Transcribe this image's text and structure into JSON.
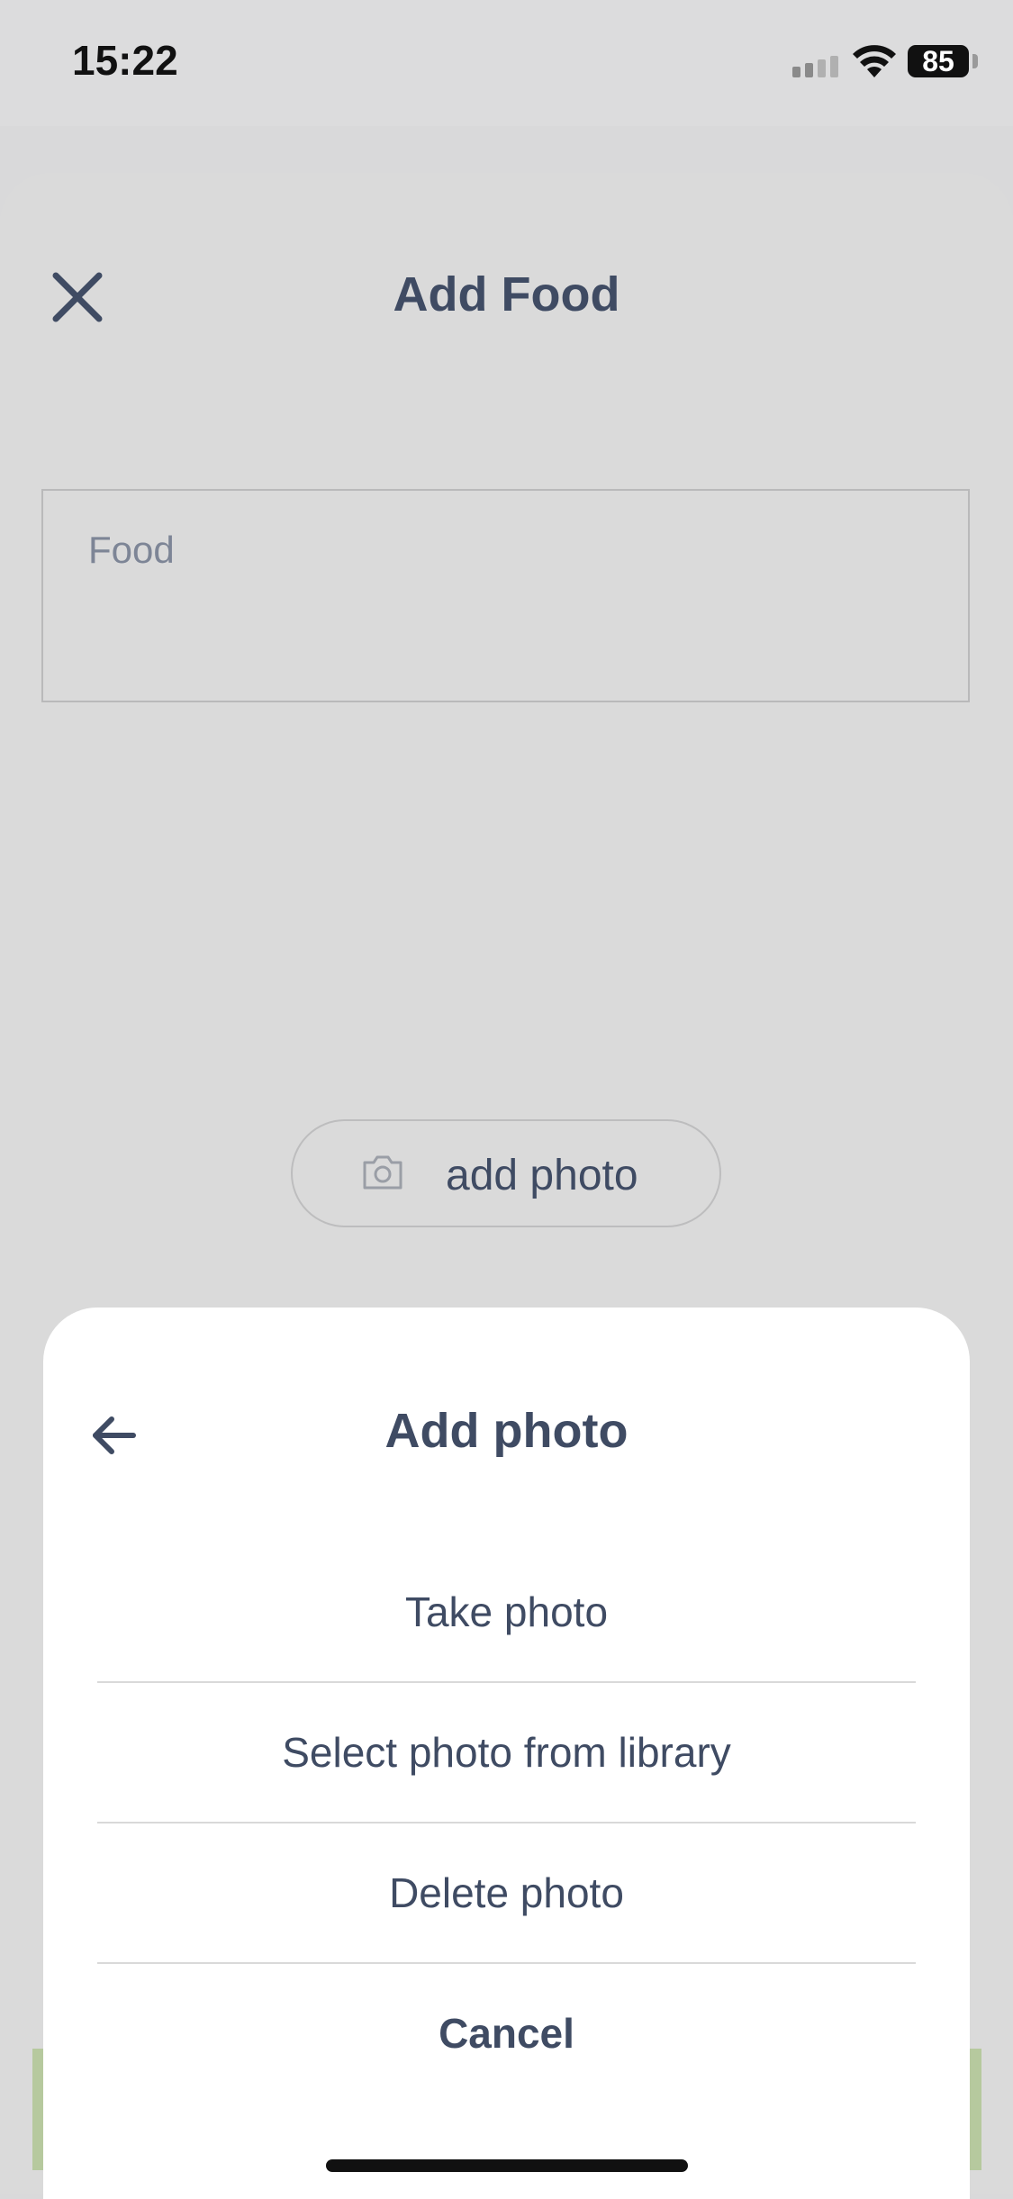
{
  "status_bar": {
    "time": "15:22",
    "battery": "85"
  },
  "header": {
    "title": "Add Food",
    "close_icon": "close-icon"
  },
  "form": {
    "food_placeholder": "Food",
    "add_photo_label": "add photo",
    "camera_icon": "camera-icon"
  },
  "action_sheet": {
    "title": "Add photo",
    "back_icon": "arrow-left-icon",
    "options": [
      {
        "label": "Take photo"
      },
      {
        "label": "Select photo from library"
      },
      {
        "label": "Delete photo"
      }
    ],
    "cancel_label": "Cancel"
  },
  "colors": {
    "text": "#3f4b63",
    "sheet_bg": "#ffffff",
    "overlay_bg": "#d9d9da",
    "accent_green": "#b6c99e"
  }
}
